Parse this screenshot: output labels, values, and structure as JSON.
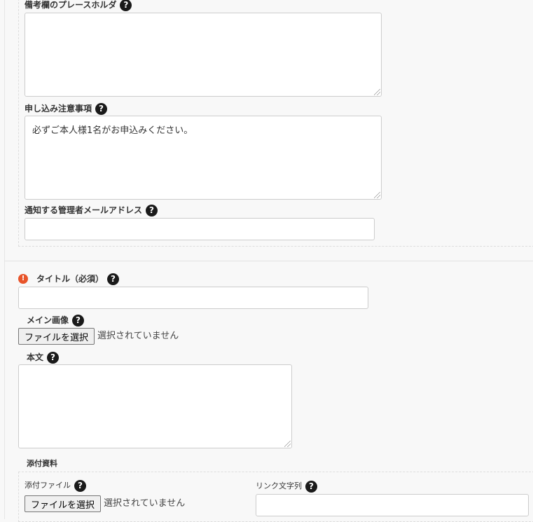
{
  "form": {
    "remarks_placeholder": {
      "label": "備考欄のプレースホルダ",
      "value": ""
    },
    "application_notes": {
      "label": "申し込み注意事項",
      "value": "必ずご本人様1名がお申込みください。"
    },
    "admin_email": {
      "label": "通知する管理者メールアドレス",
      "value": ""
    },
    "title": {
      "label": "タイトル（必須）",
      "value": ""
    },
    "main_image": {
      "label": "メイン画像",
      "button": "ファイルを選択",
      "status": "選択されていません"
    },
    "body": {
      "label": "本文",
      "value": ""
    },
    "attachments": {
      "heading": "添付資料",
      "file_label": "添付ファイル",
      "button": "ファイルを選択",
      "status": "選択されていません",
      "link_text_label": "リンク文字列",
      "link_text_value": ""
    }
  },
  "icons": {
    "help": "help-icon",
    "required": "required-icon"
  },
  "colors": {
    "required": "#e8542a",
    "help": "#1a1a1a",
    "background": "#f8f8f8"
  }
}
